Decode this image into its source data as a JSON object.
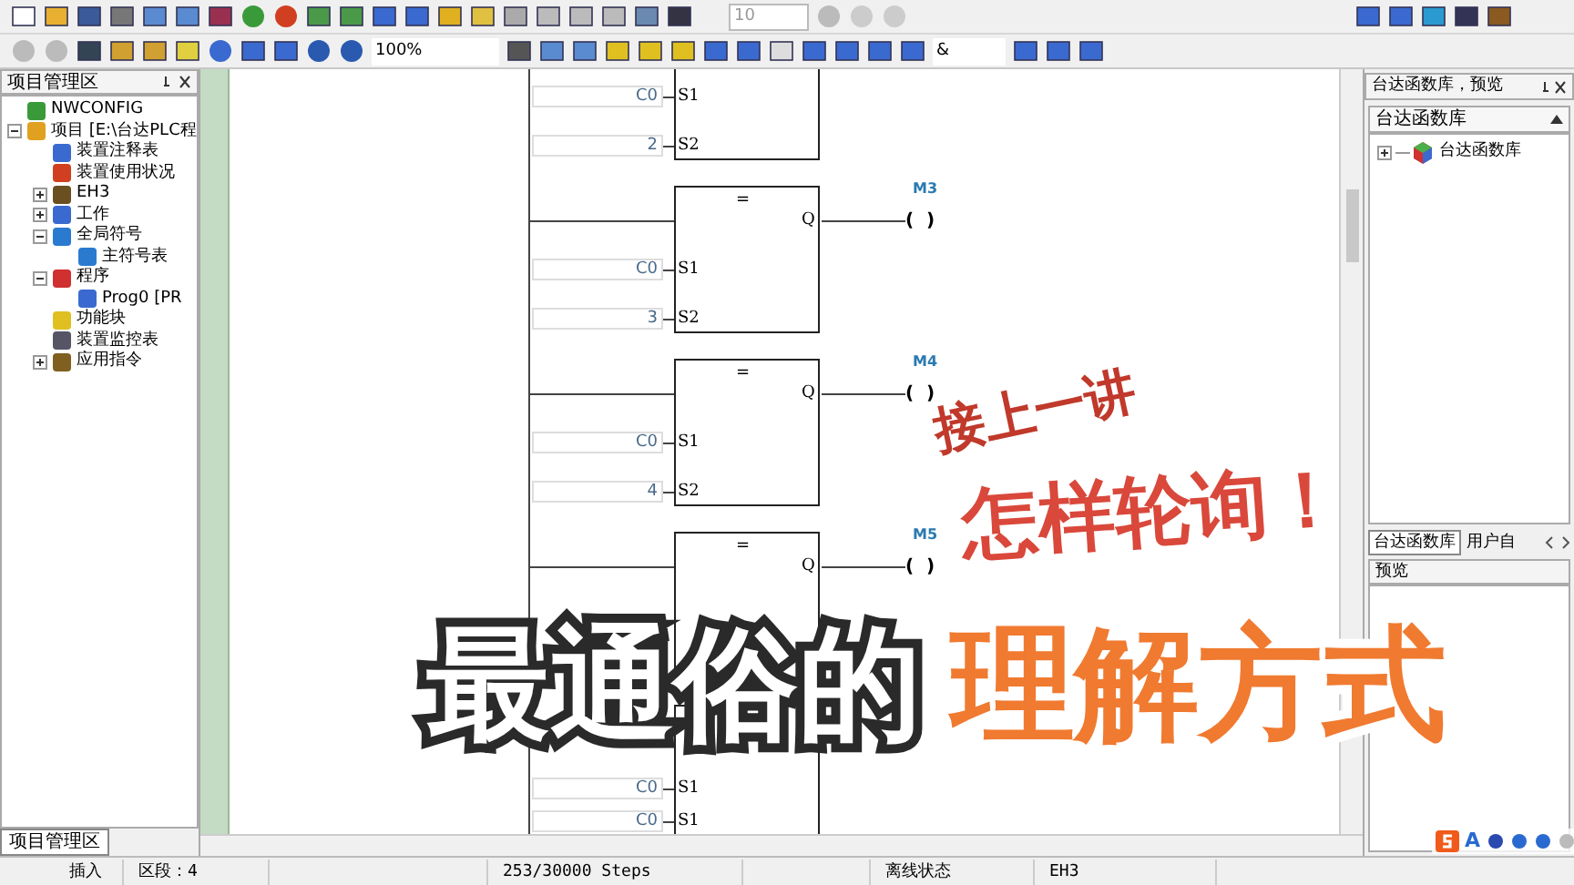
{
  "toolbar": {
    "spin_value": "10",
    "zoom": "100%",
    "logic_combo": "&"
  },
  "project_panel": {
    "title": "项目管理区",
    "tab": "项目管理区",
    "tree": [
      {
        "label": "NWCONFIG"
      },
      {
        "label": "项目 [E:\\台达PLC程",
        "expanded": true,
        "children": [
          {
            "label": "装置注释表"
          },
          {
            "label": "装置使用状况"
          },
          {
            "label": "EH3",
            "expanded": false
          },
          {
            "label": "工作",
            "expanded": false
          },
          {
            "label": "全局符号",
            "expanded": true,
            "children": [
              {
                "label": "主符号表"
              }
            ]
          },
          {
            "label": "程序",
            "expanded": true,
            "children": [
              {
                "label": "Prog0 [PR"
              }
            ]
          },
          {
            "label": "功能块"
          },
          {
            "label": "装置监控表"
          },
          {
            "label": "应用指令",
            "expanded": false
          }
        ]
      }
    ]
  },
  "ladder": {
    "blocks": [
      {
        "inputs": [
          {
            "value": "C0",
            "pin": "S1"
          },
          {
            "value": "2",
            "pin": "S2"
          }
        ]
      },
      {
        "op": "=",
        "out_pin": "Q",
        "coil": "(  )",
        "coil_label": "M3",
        "inputs": [
          {
            "value": "C0",
            "pin": "S1"
          },
          {
            "value": "3",
            "pin": "S2"
          }
        ]
      },
      {
        "op": "=",
        "out_pin": "Q",
        "coil": "(  )",
        "coil_label": "M4",
        "inputs": [
          {
            "value": "C0",
            "pin": "S1"
          },
          {
            "value": "4",
            "pin": "S2"
          }
        ]
      },
      {
        "op": "=",
        "out_pin": "Q",
        "coil": "(  )",
        "coil_label": "M5"
      },
      {
        "inputs": [
          {
            "value": "C0",
            "pin": "S1"
          },
          {
            "value": "C0",
            "pin": "S1"
          }
        ]
      }
    ]
  },
  "library_panel": {
    "title": "台达函数库，预览",
    "dropdown": "台达函数库",
    "tree": [
      {
        "label": "台达函数库",
        "expanded": false
      }
    ],
    "tabs": [
      {
        "label": "台达函数库",
        "selected": true
      },
      {
        "label": "用户自",
        "selected": false
      }
    ],
    "preview_title": "预览"
  },
  "captions": [
    {
      "kind": "tilted",
      "text": "接上一讲"
    },
    {
      "kind": "red",
      "text": "怎样轮询！"
    },
    {
      "kind": "white",
      "text": "最通俗的"
    },
    {
      "kind": "orange",
      "text": "理解方式"
    }
  ],
  "ime_mode": "A",
  "status_bar": [
    "插入",
    "区段：4",
    "253/30000 Steps",
    "离线状态",
    "EH3"
  ]
}
